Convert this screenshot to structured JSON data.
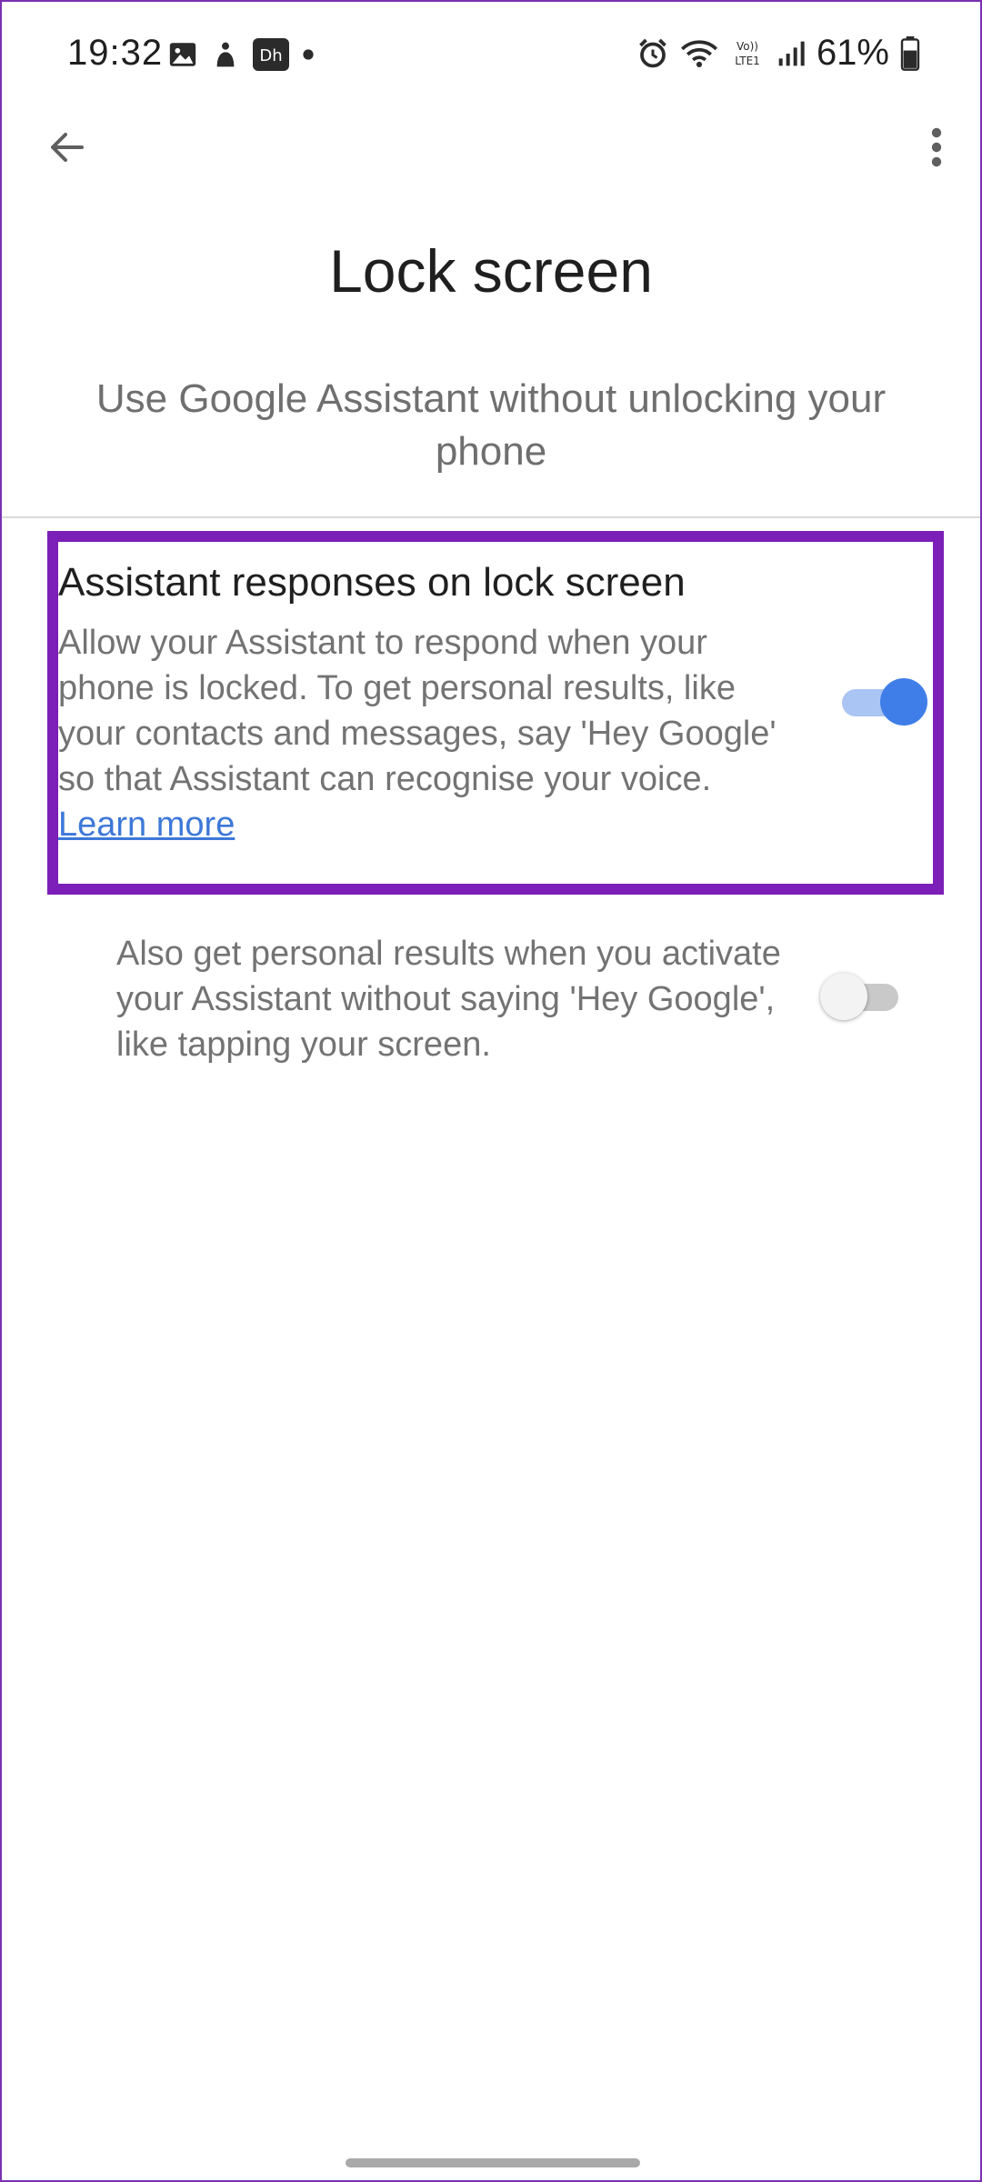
{
  "status_bar": {
    "time": "19:32",
    "battery": "61%",
    "left_icons": [
      "image-icon",
      "figure-icon",
      "hotstar-icon",
      "dot-icon"
    ],
    "right_icons": [
      "alarm-icon",
      "wifi-icon",
      "volte-icon",
      "signal-icon",
      "battery-icon"
    ],
    "volte_label_top": "Vo))",
    "volte_label_bottom": "LTE1",
    "app_badge": "Dh"
  },
  "app_bar": {
    "back_icon": "arrow-back-icon",
    "more_icon": "more-vert-icon"
  },
  "page": {
    "title": "Lock screen",
    "subtitle": "Use Google Assistant without unlocking your phone"
  },
  "settings": {
    "assistant_responses": {
      "title": "Assistant responses on lock screen",
      "description": "Allow your Assistant to respond when your phone is locked. To get personal results, like your contacts and messages, say 'Hey Google' so that Assistant can recognise your voice. ",
      "link": "Learn more",
      "enabled": true
    },
    "personal_results": {
      "description": "Also get personal results when you activate your Assistant without saying 'Hey Google', like tapping your screen.",
      "enabled": false
    }
  },
  "colors": {
    "highlight": "#7b1fb8",
    "toggle_on": "#3f7ee8",
    "link": "#3d78d8"
  }
}
